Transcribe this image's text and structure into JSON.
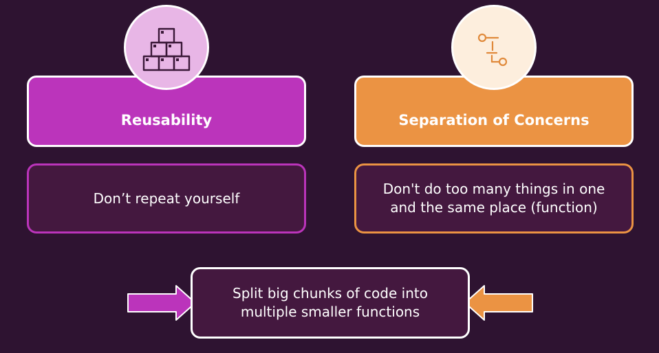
{
  "colors": {
    "background": "#2e1331",
    "reusability_accent": "#bb34bb",
    "reusability_light": "#e8b6e6",
    "soc_accent": "#eb9343",
    "soc_light": "#fdeedd",
    "desc_fill": "#44183f"
  },
  "reusability": {
    "icon": "stacked-boxes-icon",
    "title": "Reusability",
    "description": "Don’t repeat yourself"
  },
  "separation": {
    "icon": "flow-connector-icon",
    "title": "Separation of Concerns",
    "description_line1": "Don't do too many things in one",
    "description_line2": "and the same place (function)"
  },
  "result": {
    "line1": "Split big chunks of code into",
    "line2": "multiple smaller functions"
  }
}
